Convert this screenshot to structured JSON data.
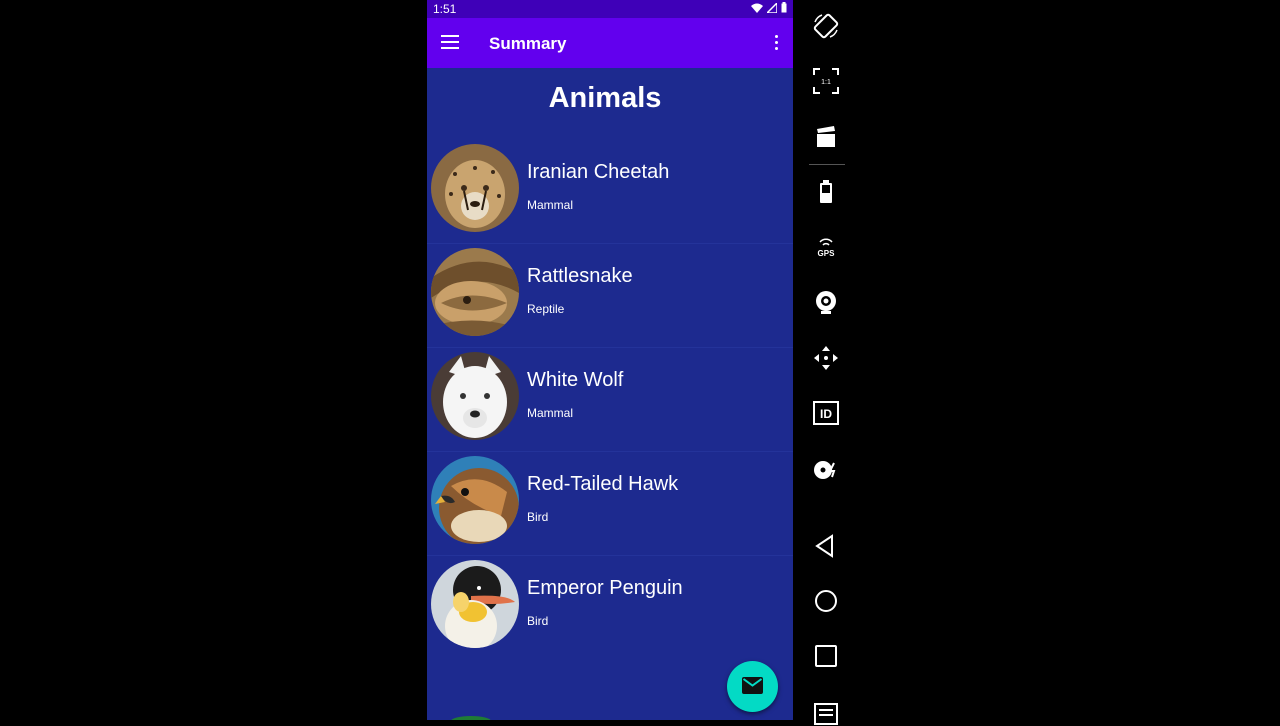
{
  "status_bar": {
    "time": "1:51"
  },
  "app_bar": {
    "title": "Summary"
  },
  "page": {
    "title": "Animals"
  },
  "animals": [
    {
      "name": "Iranian Cheetah",
      "class": "Mammal"
    },
    {
      "name": "Rattlesnake",
      "class": "Reptile"
    },
    {
      "name": "White Wolf",
      "class": "Mammal"
    },
    {
      "name": "Red-Tailed Hawk",
      "class": "Bird"
    },
    {
      "name": "Emperor Penguin",
      "class": "Bird"
    }
  ],
  "fab": {
    "icon": "mail-icon",
    "color": "#03dac5"
  },
  "colors": {
    "app_bar": "#6200ee",
    "status_bar": "#3f00b8",
    "background": "#1d2a8f"
  },
  "emulator_toolbar": {
    "icons": [
      "rotate-icon",
      "scale-icon",
      "screen-record-icon",
      "battery-icon",
      "gps-icon",
      "camera-icon",
      "move-icon",
      "id-icon",
      "disk-icon",
      "back-icon",
      "home-icon",
      "recents-icon",
      "menu-icon"
    ],
    "gps_label": "GPS",
    "id_label": "ID",
    "scale_label": "1:1"
  }
}
